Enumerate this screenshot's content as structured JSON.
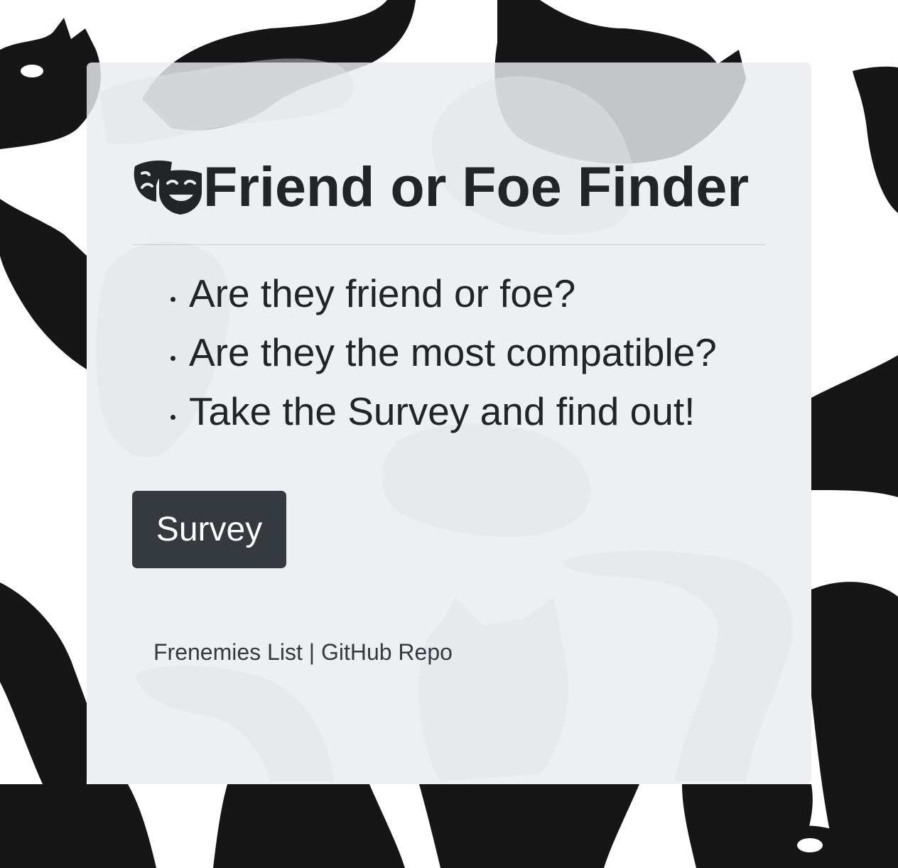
{
  "page": {
    "title": "Friend or Foe Finder",
    "title_icon": "theater-masks-icon",
    "background": "black-cats-pattern"
  },
  "points": [
    "Are they friend or foe?",
    "Are they the most compatible?",
    "Take the Survey and find out!"
  ],
  "survey_button": {
    "label": "Survey"
  },
  "footer": {
    "links": [
      {
        "label": "Frenemies List"
      },
      {
        "label": "GitHub Repo"
      }
    ],
    "separator": "|"
  },
  "colors": {
    "jumbotron_bg": "#e9ecef",
    "text": "#212529",
    "button_bg": "#343a40",
    "button_text": "#ffffff"
  }
}
